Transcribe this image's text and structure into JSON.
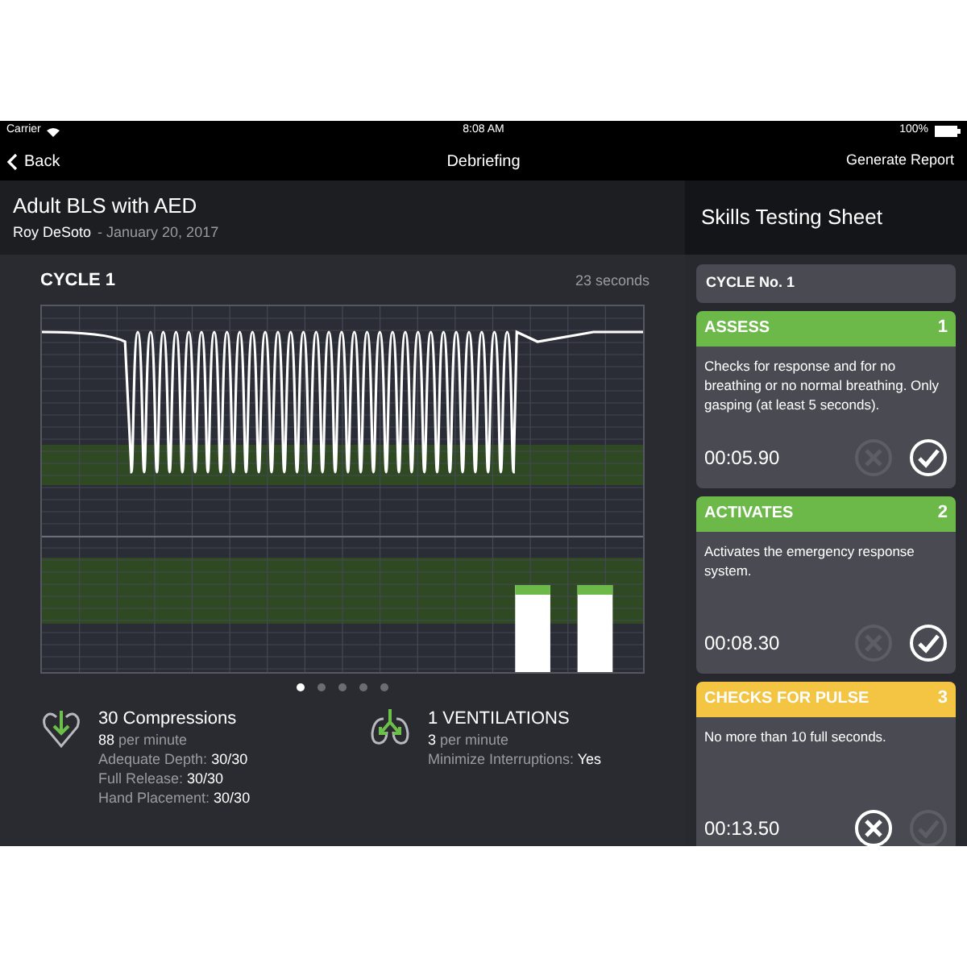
{
  "status_bar": {
    "carrier": "Carrier",
    "time": "8:08 AM",
    "battery": "100%"
  },
  "nav_bar": {
    "back": "Back",
    "title": "Debriefing",
    "action": "Generate Report"
  },
  "scenario": {
    "title": "Adult BLS with AED",
    "student": "Roy DeSoto",
    "date": "- January 20, 2017"
  },
  "cycle": {
    "title": "CYCLE 1",
    "duration": "23 seconds"
  },
  "pages": [
    {
      "selected": true
    },
    {
      "selected": false
    },
    {
      "selected": false
    },
    {
      "selected": false
    },
    {
      "selected": false
    }
  ],
  "stats": [
    {
      "kind": "compressions",
      "title": "30 Compressions",
      "rate": "88",
      "rate_unit": "per minute",
      "lines": [
        {
          "label": "Adequate Depth:",
          "value": "30/30"
        },
        {
          "label": "Full Release:",
          "value": "30/30"
        },
        {
          "label": "Hand Placement:",
          "value": "30/30"
        }
      ]
    },
    {
      "kind": "ventilations",
      "title": "1 VENTILATIONS",
      "rate": "3",
      "rate_unit": "per minute",
      "lines": [
        {
          "label": "Minimize Interruptions:",
          "value": "Yes"
        }
      ]
    }
  ],
  "sheet": {
    "title": "Skills Testing Sheet",
    "cycle_label": "CYCLE No. 1",
    "steps": [
      {
        "title": "ASSESS",
        "number": "1",
        "color": "#6cb94a",
        "description": "Checks for response and for no breathing or no normal breathing. Only gasping (at least 5 seconds).",
        "time": "00:05.90",
        "passed": true
      },
      {
        "title": "ACTIVATES",
        "number": "2",
        "color": "#6cb94a",
        "description": "Activates the emergency response system.",
        "time": "00:08.30",
        "passed": true
      },
      {
        "title": "CHECKS FOR PULSE",
        "number": "3",
        "color": "#f4c443",
        "description": "No more than 10 full seconds.",
        "time": "00:13.50",
        "passed": false
      }
    ]
  }
}
